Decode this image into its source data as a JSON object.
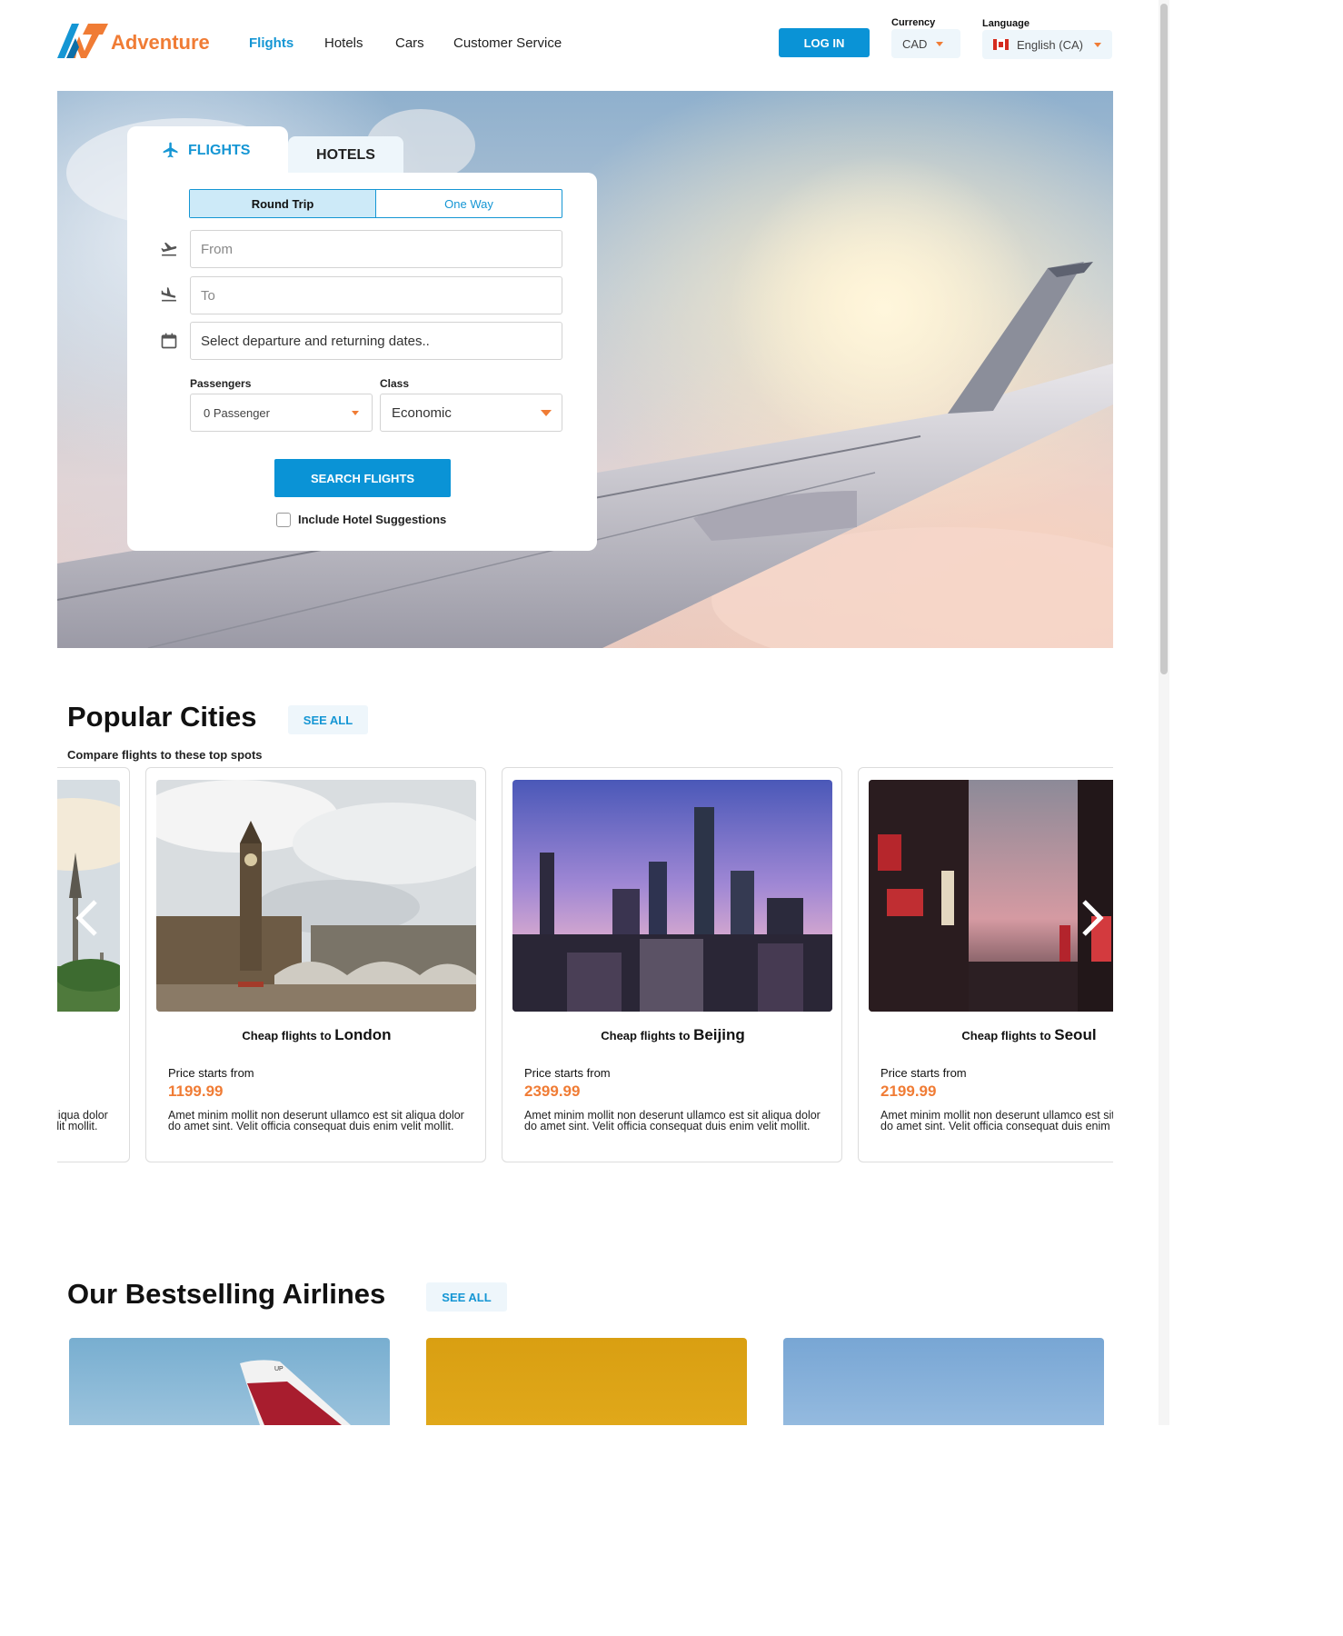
{
  "header": {
    "brand": "Adventure",
    "nav": [
      "Flights",
      "Hotels",
      "Cars",
      "Customer Service"
    ],
    "login": "LOG IN",
    "currency": {
      "label": "Currency",
      "value": "CAD"
    },
    "language": {
      "label": "Language",
      "value": "English (CA)"
    }
  },
  "search": {
    "tabs": {
      "flights": "FLIGHTS",
      "hotels": "HOTELS"
    },
    "trip_types": [
      "Round Trip",
      "One Way"
    ],
    "from_placeholder": "From",
    "to_placeholder": "To",
    "dates_placeholder": "Select departure and returning dates..",
    "passengers_label": "Passengers",
    "passengers_value": "0 Passenger",
    "class_label": "Class",
    "class_value": "Economic",
    "search_button": "SEARCH FLIGHTS",
    "hotel_suggestions": "Include Hotel Suggestions"
  },
  "popular": {
    "title": "Popular Cities",
    "see_all": "SEE ALL",
    "subtitle": "Compare flights to these top spots",
    "prefix": "Cheap flights to",
    "price_label": "Price starts from",
    "desc": "Amet minim mollit non deserunt ullamco est sit aliqua dolor do amet sint. Velit officia consequat duis enim velit mollit.",
    "cities": [
      {
        "name": "London",
        "price": "1199.99"
      },
      {
        "name": "Beijing",
        "price": "2399.99"
      },
      {
        "name": "Seoul",
        "price": "2199.99"
      }
    ]
  },
  "airlines": {
    "title": "Our Bestselling Airlines",
    "see_all": "SEE ALL"
  },
  "colors": {
    "accent": "#1596d4",
    "brand": "#f07c35",
    "button": "#0a93d6"
  }
}
